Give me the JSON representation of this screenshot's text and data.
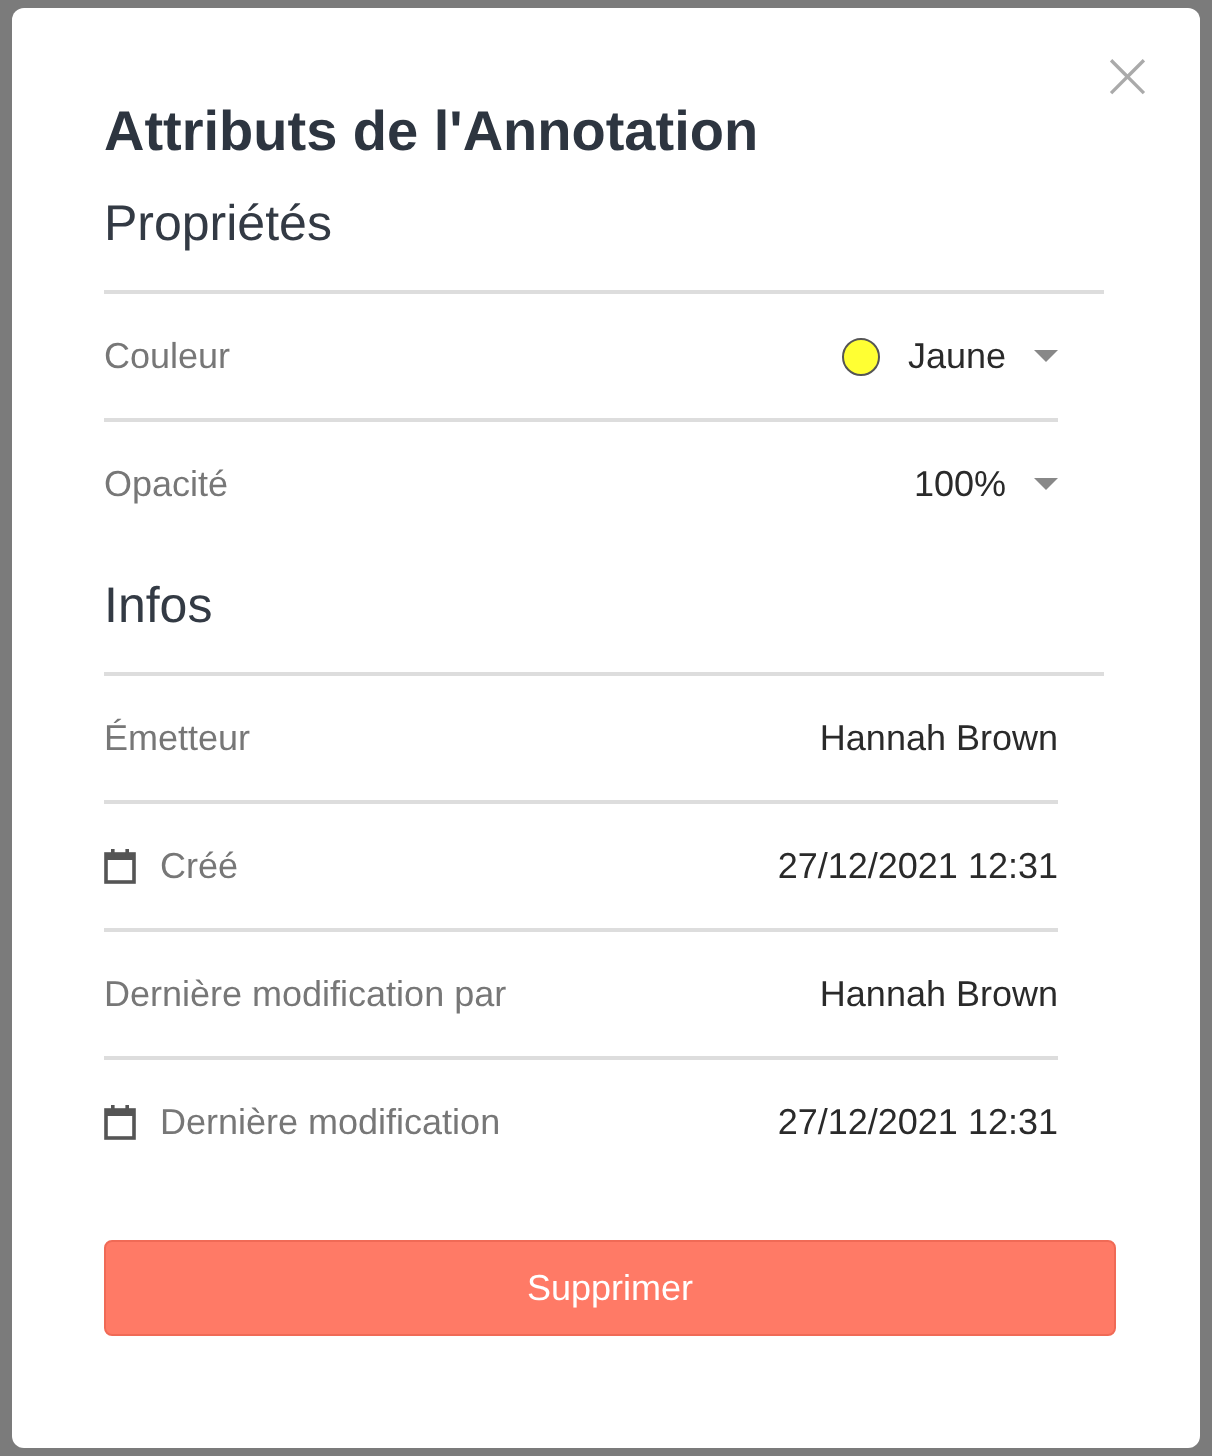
{
  "dialog": {
    "title": "Attributs de l'Annotation",
    "close": "×"
  },
  "sections": [
    {
      "heading": "Propriétés",
      "rows": [
        {
          "kind": "select",
          "label": "Couleur",
          "value": "Jaune",
          "color": "#ffff33"
        },
        {
          "kind": "select",
          "label": "Opacité",
          "value": "100%"
        }
      ]
    },
    {
      "heading": "Infos",
      "rows": [
        {
          "kind": "info",
          "label": "Émetteur",
          "value": "Hannah Brown"
        },
        {
          "kind": "date",
          "label": "Créé",
          "value": "27/12/2021 12:31"
        },
        {
          "kind": "info",
          "label": "Dernière modification par",
          "value": "Hannah Brown"
        },
        {
          "kind": "date",
          "label": "Dernière modification",
          "value": "27/12/2021 12:31"
        }
      ]
    }
  ],
  "delete_button": "Supprimer"
}
